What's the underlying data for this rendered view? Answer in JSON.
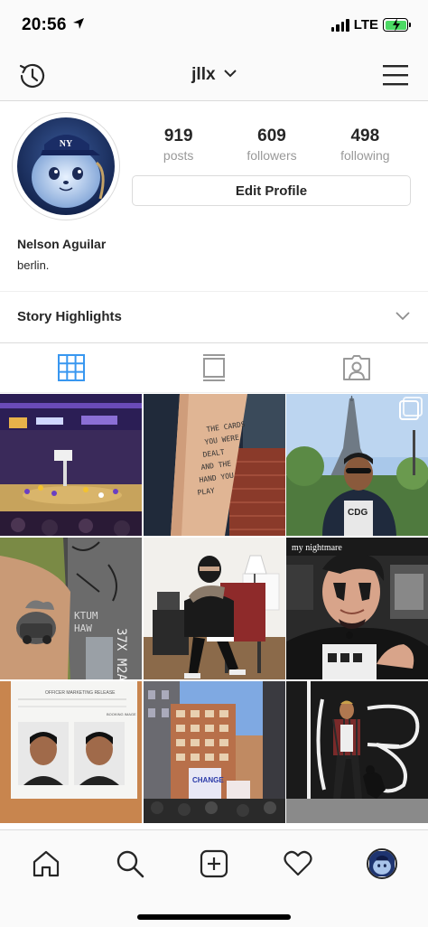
{
  "status_bar": {
    "time": "20:56",
    "network": "LTE",
    "battery_color": "#4cd964"
  },
  "nav": {
    "username": "jllx",
    "history_icon": "history-icon",
    "menu_icon": "hamburger-menu-icon",
    "dropdown_icon": "chevron-down-icon"
  },
  "profile": {
    "name": "Nelson Aguilar",
    "bio": "berlin.",
    "edit_label": "Edit Profile",
    "stats": [
      {
        "value": "919",
        "label": "posts"
      },
      {
        "value": "609",
        "label": "followers"
      },
      {
        "value": "498",
        "label": "following"
      }
    ]
  },
  "highlights": {
    "label": "Story Highlights"
  },
  "tabs": [
    {
      "name": "grid-view-icon",
      "active": true
    },
    {
      "name": "feed-view-icon",
      "active": false
    },
    {
      "name": "tagged-photos-icon",
      "active": false
    }
  ],
  "grid": {
    "posts": [
      {
        "desc": "basketball-arena"
      },
      {
        "desc": "arm-tattoo-text"
      },
      {
        "desc": "eiffel-tower-selfie"
      },
      {
        "desc": "arm-tattoo-car"
      },
      {
        "desc": "masked-person-chair"
      },
      {
        "desc": "face-paint-portrait"
      },
      {
        "desc": "mugshot-poster"
      },
      {
        "desc": "city-protest"
      },
      {
        "desc": "mural-dog-walk"
      }
    ],
    "tattoo_text": "THE CARDS YOU WERE DEALT AND THE HAND YOU PLAY",
    "face_caption": "my nightmare",
    "mugshot_header": "OFFICER MARKETING RELEASE",
    "mugshot_tag": "BOOKING IMAGE",
    "protest_sign": "CHANGE"
  },
  "bottom_nav": [
    {
      "name": "home-icon"
    },
    {
      "name": "search-icon"
    },
    {
      "name": "add-post-icon"
    },
    {
      "name": "activity-heart-icon"
    },
    {
      "name": "profile-avatar-icon"
    }
  ]
}
